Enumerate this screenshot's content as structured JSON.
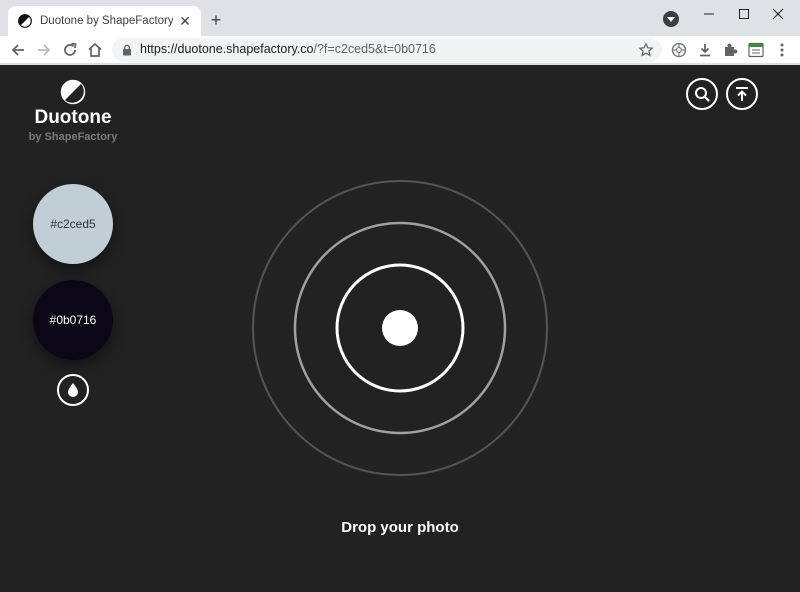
{
  "browser": {
    "tab": {
      "title": "Duotone by ShapeFactory | Cre",
      "favicon": "duotone-logo-icon"
    },
    "url": {
      "host": "https://duotone.shapefactory.co",
      "path": "/?f=c2ced5&t=0b0716"
    }
  },
  "app": {
    "brand": {
      "title": "Duotone",
      "subtitle": "by ShapeFactory"
    },
    "colors": {
      "from": {
        "label": "#c2ced5",
        "hex": "#c2ced5"
      },
      "to": {
        "label": "#0b0716",
        "hex": "#0b0716"
      },
      "background": "#222222"
    },
    "dropzone": {
      "label": "Drop your photo"
    },
    "icons": {
      "search": "search-icon",
      "upload": "upload-icon",
      "dropper": "droplet-icon"
    }
  }
}
